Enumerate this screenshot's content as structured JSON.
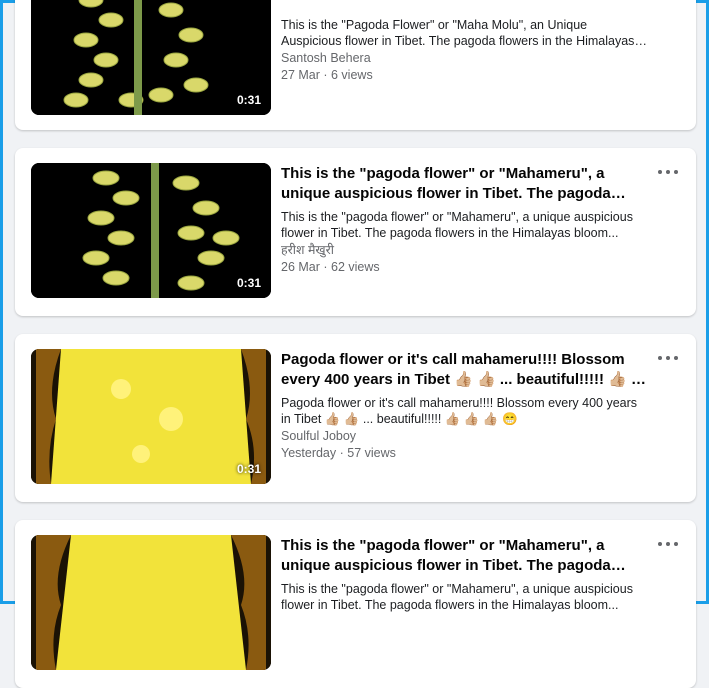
{
  "videos": [
    {
      "title": "",
      "description": "This is the \"Pagoda Flower\" or \"Maha Molu\", an Unique Auspicious flower in Tibet. The pagoda flowers in the Himalayas bloom...",
      "author": "Santosh Behera",
      "meta": "27 Mar · 6 views",
      "duration": "0:31",
      "thumb_color": "#e8e070"
    },
    {
      "title": "This is the \"pagoda flower\" or \"Mahameru\", a unique auspicious flower in Tibet. The pagoda flowers in the Himalayas bloom...",
      "description": "This is the \"pagoda flower\" or \"Mahameru\", a unique auspicious flower in Tibet. The pagoda flowers in the Himalayas bloom...",
      "author": "हरीश मैखुरी",
      "meta": "26 Mar · 62 views",
      "duration": "0:31",
      "thumb_color": "#e8e070"
    },
    {
      "title": "Pagoda flower or it's call mahameru!!!! Blossom every 400 years in Tibet 👍🏼 👍🏼 ... beautiful!!!!! 👍🏼 👍🏼 👍🏼 😁",
      "description": "Pagoda flower or it's call mahameru!!!! Blossom every 400 years in Tibet 👍🏼 👍🏼 ... beautiful!!!!! 👍🏼 👍🏼 👍🏼 😁",
      "author": "Soulful Joboy",
      "meta": "Yesterday · 57 views",
      "duration": "0:31",
      "thumb_color": "#f2e33a"
    },
    {
      "title": "This is the \"pagoda flower\" or \"Mahameru\", a unique auspicious flower in Tibet. The pagoda flowers in the Himalayas bloom...",
      "description": "This is the \"pagoda flower\" or \"Mahameru\", a unique auspicious flower in Tibet. The pagoda flowers in the Himalayas bloom...",
      "author": "",
      "meta": "",
      "duration": "",
      "thumb_color": "#f2e33a"
    }
  ]
}
